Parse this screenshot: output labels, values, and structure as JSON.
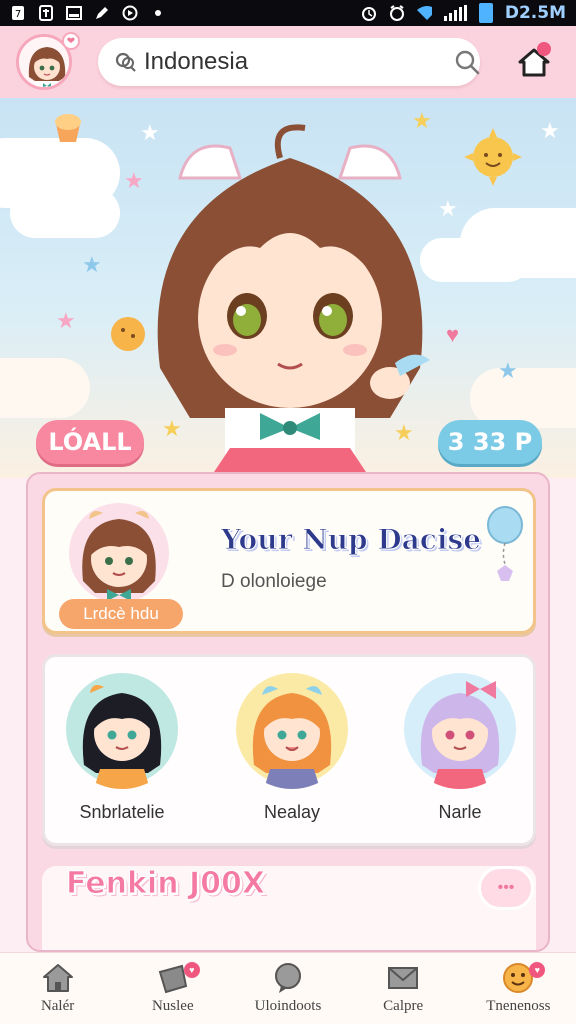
{
  "status_bar": {
    "time": "D2.5M",
    "icons": [
      "notification-icon",
      "download-icon",
      "image-icon",
      "edit-icon",
      "play-icon",
      "alarm-icon",
      "wifi-icon",
      "signal-icon",
      "battery-icon"
    ]
  },
  "header": {
    "search": {
      "value": "Indonesia",
      "placeholder": "Indonesia"
    },
    "avatar_badge": "❤"
  },
  "hero": {
    "left_pill": "LÓALL",
    "right_pill": "3 33 P"
  },
  "featured": {
    "title": "Your Nup Dacise",
    "subtitle": "D olonloiege",
    "tag": "Lrdcè hdu"
  },
  "characters": [
    {
      "name": "Snbrlatelie"
    },
    {
      "name": "Nealay"
    },
    {
      "name": "Narle"
    }
  ],
  "section": {
    "title": "Fenkin J00X",
    "speech_icon": "•••"
  },
  "bottom_nav": [
    {
      "label": "Nalér",
      "icon": "house-icon"
    },
    {
      "label": "Nuslee",
      "icon": "music-icon"
    },
    {
      "label": "Uloindoots",
      "icon": "chat-bubble-icon"
    },
    {
      "label": "Calpre",
      "icon": "mail-icon"
    },
    {
      "label": "Tnenenoss",
      "icon": "smiley-icon"
    }
  ],
  "colors": {
    "header_bg": "#fbd3de",
    "accent_pink": "#f7889f",
    "accent_blue": "#7ccbe6",
    "title_navy": "#2e3a8c"
  }
}
